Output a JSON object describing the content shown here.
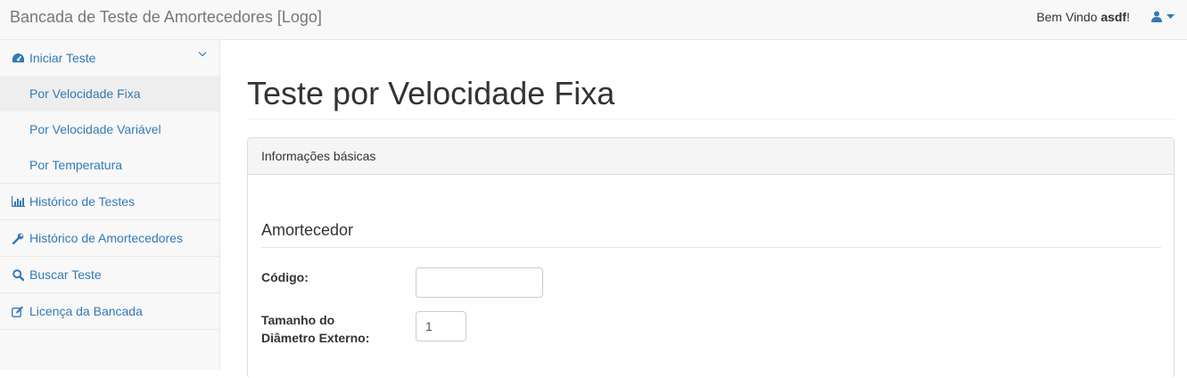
{
  "header": {
    "brand": "Bancada de Teste de Amortecedores [Logo]",
    "welcome_prefix": "Bem Vindo ",
    "username": "asdf",
    "welcome_suffix": "!"
  },
  "sidebar": {
    "start_test": "Iniciar Teste",
    "sub_items": [
      "Por Velocidade Fixa",
      "Por Velocidade Variável",
      "Por Temperatura"
    ],
    "items": [
      "Histórico de Testes",
      "Histórico de Amortecedores",
      "Buscar Teste",
      "Licença da Bancada"
    ]
  },
  "main": {
    "title": "Teste por Velocidade Fixa",
    "panel_heading": "Informações básicas",
    "section_title": "Amortecedor",
    "code_label": "Código:",
    "code_value": "",
    "diameter_label_line1": "Tamanho do",
    "diameter_label_line2": "Diâmetro Externo:",
    "diameter_value": "1"
  },
  "colors": {
    "link": "#337ab7",
    "navbar_bg": "#f8f8f8",
    "active_item_bg": "#eeeeee"
  }
}
